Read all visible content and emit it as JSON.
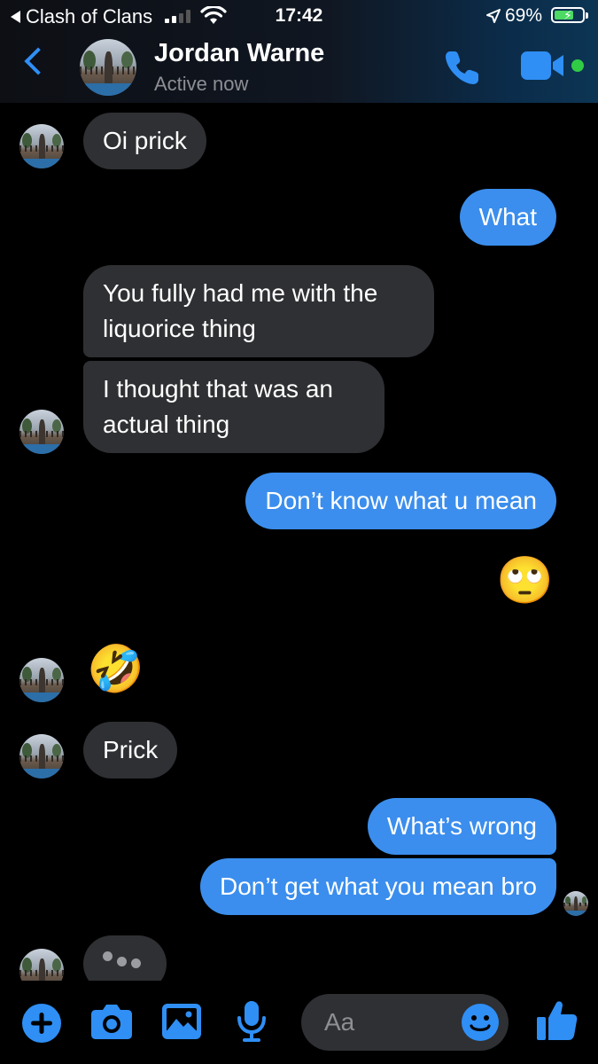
{
  "status_bar": {
    "back_app": "Clash of Clans",
    "time": "17:42",
    "battery_percent": "69%",
    "battery_level": 0.69,
    "signal_bars": 2
  },
  "header": {
    "contact_name": "Jordan Warne",
    "contact_status": "Active now",
    "icons": [
      "back-chevron-icon",
      "phone-icon",
      "video-camera-icon",
      "online-status-dot"
    ]
  },
  "messages": [
    {
      "side": "in",
      "text": "Oi prick"
    },
    {
      "side": "out",
      "text": "What"
    },
    {
      "side": "in",
      "text": "You fully had me with the liquorice thing"
    },
    {
      "side": "in",
      "text": "I thought that was an actual thing"
    },
    {
      "side": "out",
      "text": "Don’t know what u mean"
    },
    {
      "side": "out",
      "text": "🙄"
    },
    {
      "side": "in",
      "text": "🤣"
    },
    {
      "side": "in",
      "text": "Prick"
    },
    {
      "side": "out",
      "text": "What’s wrong"
    },
    {
      "side": "out",
      "text": "Don’t get what you mean bro"
    }
  ],
  "typing_indicator": true,
  "composer": {
    "placeholder": "Aa",
    "icons": [
      "plus-icon",
      "camera-icon",
      "gallery-icon",
      "microphone-icon",
      "emoji-icon",
      "thumbs-up-icon"
    ]
  },
  "colors": {
    "outgoing_bubble": "#3b8eed",
    "incoming_bubble": "#2f3033",
    "accent": "#2f8ff5",
    "online": "#31cc46"
  }
}
